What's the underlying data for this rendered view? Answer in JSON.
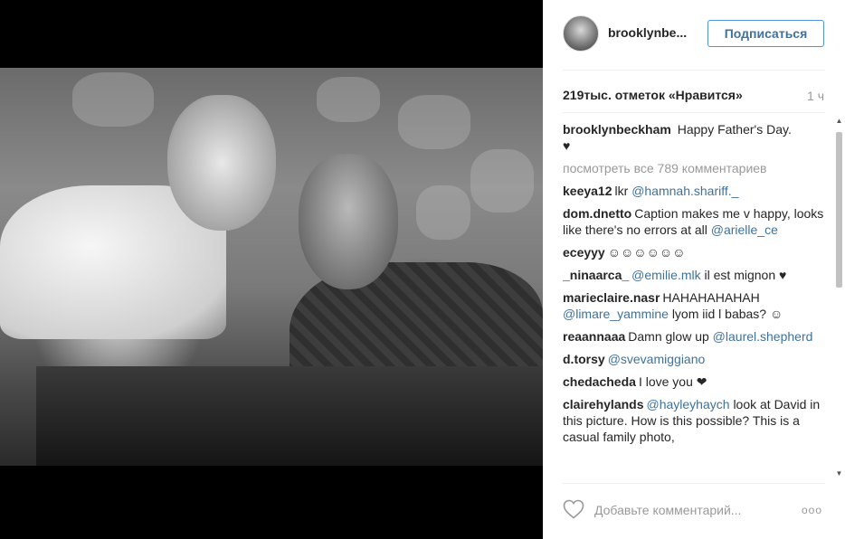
{
  "post": {
    "photo_alt": "black and white photo"
  },
  "header": {
    "username": "brooklynbe...",
    "follow_label": "Подписаться"
  },
  "stats": {
    "likes": "219тыс. отметок «Нравится»",
    "time": "1 ч"
  },
  "caption": {
    "user": "brooklynbeckham",
    "text": "Happy Father's Day.",
    "emoji": "♥"
  },
  "view_all": "посмотреть все 789 комментариев",
  "comments": [
    {
      "user": "keeya12",
      "text": "lkr",
      "mention": "@hamnah.shariff._",
      "after": ""
    },
    {
      "user": "dom.dnetto",
      "text": "Caption makes me v happy, looks like there's no errors at all",
      "mention": "@arielle_ce",
      "after": ""
    },
    {
      "user": "eceyyy",
      "text": "☺☺☺☺☺☺",
      "mention": "",
      "after": ""
    },
    {
      "user": "_ninaarca_",
      "text": "",
      "mention": "@emilie.mlk",
      "after": "il est mignon ♥"
    },
    {
      "user": "marieclaire.nasr",
      "text": "HAHAHAHAHAH",
      "mention": "@limare_yammine",
      "after": "lyom iid l babas? ☺"
    },
    {
      "user": "reaannaaa",
      "text": "Damn glow up",
      "mention": "@laurel.shepherd",
      "after": ""
    },
    {
      "user": "d.torsy",
      "text": "",
      "mention": "@svevamiggiano",
      "after": ""
    },
    {
      "user": "chedacheda",
      "text": "I love you ❤",
      "mention": "",
      "after": ""
    },
    {
      "user": "clairehylands",
      "text": "",
      "mention": "@hayleyhaych",
      "after": "look at David in this picture. How is this possible? This is a casual family photo,"
    }
  ],
  "composer": {
    "placeholder": "Добавьте комментарий...",
    "more_label": "ooo"
  },
  "colors": {
    "link": "#3f729b",
    "follow_border": "#4f93d8",
    "muted": "#999999"
  },
  "icons": {
    "like": "heart-outline-icon",
    "more": "more-options-icon"
  }
}
